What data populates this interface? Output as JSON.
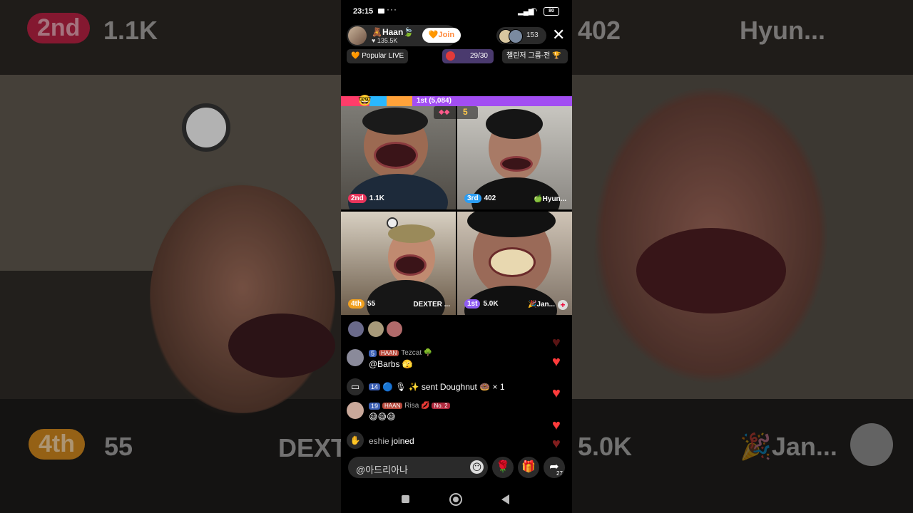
{
  "background": {
    "left_rank": "2nd",
    "left_score": "1.1K",
    "right_score": "402",
    "right_name": "Hyun...",
    "bottom_left_rank": "4th",
    "bottom_left_score": "55",
    "bottom_left_name": "DEXT",
    "bottom_right_score": "5.0K",
    "bottom_right_name": "🎉Jan..."
  },
  "status_bar": {
    "time": "23:15",
    "dots": "···",
    "battery": "80"
  },
  "host": {
    "name": "🧸Haan🍃",
    "likes": "♥ 135.5K",
    "join_label": "🧡Join"
  },
  "viewers": {
    "count": "153"
  },
  "close_icon": "✕",
  "chips": {
    "popular": "🧡 Popular LIVE",
    "quest": "29/30",
    "challenger": "챌린저 그룹-전 🏆"
  },
  "battle": {
    "leader_label": "1st (5,084)",
    "wins": "5",
    "emoji": "🤓"
  },
  "players": [
    {
      "rank": "2nd",
      "score": "1.1K",
      "name": "",
      "rank_color": "#e8335a"
    },
    {
      "rank": "3rd",
      "score": "402",
      "name": "🍏Hyun...",
      "rank_color": "#2a9df4"
    },
    {
      "rank": "4th",
      "score": "55",
      "name": "DEXTER ...",
      "rank_color": "#f0a020"
    },
    {
      "rank": "1st",
      "score": "5.0K",
      "name": "🎉Jan...",
      "rank_color": "#8e5cf2"
    }
  ],
  "chat": [
    {
      "level": "5",
      "fan_badge": "HAAN",
      "user": "Tezcat 🌳",
      "text": "@Barbs 🫣"
    },
    {
      "level": "14",
      "extra": "🔵 🎙 ✨",
      "text": "sent Doughnut 🍩 × 1"
    },
    {
      "level": "19",
      "fan_badge": "HAAN",
      "user": "Risa 💋",
      "rank_badge": "No. 2",
      "text": "😅😅😅"
    },
    {
      "user": "eshie",
      "text": "joined"
    }
  ],
  "input": {
    "placeholder": "@아드리아나",
    "emoji_icon": "😶"
  },
  "actions": {
    "rose": "🌹",
    "gift": "🎁",
    "share": "➦",
    "share_count": "27"
  },
  "colors": {
    "battle_bar": "#a24ef2",
    "join_text": "#ff8a3d",
    "heart": "#ff3b3b"
  }
}
